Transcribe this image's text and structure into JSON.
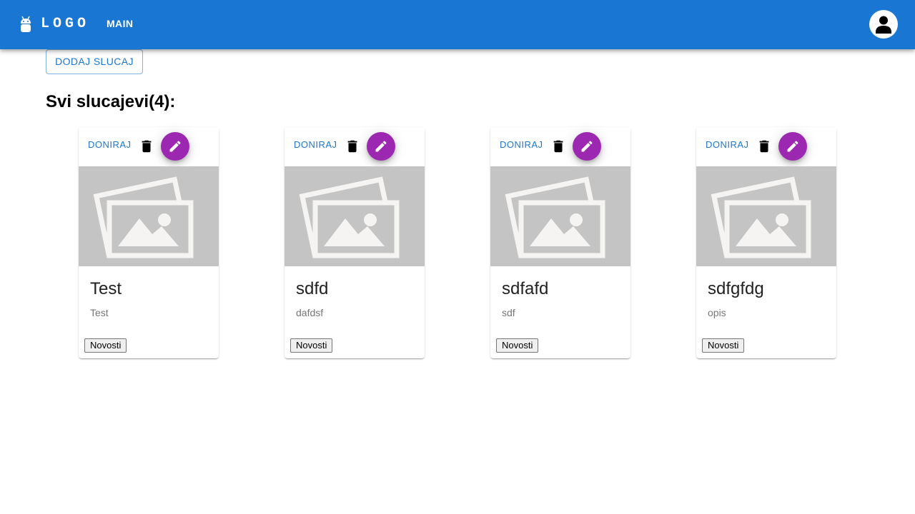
{
  "header": {
    "logo_text": "LOGO",
    "nav_main": "MAIN",
    "primary_color": "#1976d2"
  },
  "actions": {
    "add_case_label": "DODAJ SLUCAJ"
  },
  "page_title": "Svi slucajevi(4):",
  "cards": [
    {
      "donate_label": "DONIRAJ",
      "title": "Test",
      "description": "Test",
      "tag": "Novosti"
    },
    {
      "donate_label": "DONIRAJ",
      "title": "sdfd",
      "description": "dafdsf",
      "tag": "Novosti"
    },
    {
      "donate_label": "DONIRAJ",
      "title": "sdfafd",
      "description": "sdf",
      "tag": "Novosti"
    },
    {
      "donate_label": "DONIRAJ",
      "title": "sdfgfdg",
      "description": "opis",
      "tag": "Novosti"
    }
  ],
  "icons": {
    "logo": "android-icon",
    "avatar": "account-icon",
    "delete": "trash-icon",
    "edit": "pencil-icon",
    "placeholder": "image-placeholder-icon"
  },
  "colors": {
    "fab": "#9c27b0",
    "media_background": "#c4c4c4"
  }
}
